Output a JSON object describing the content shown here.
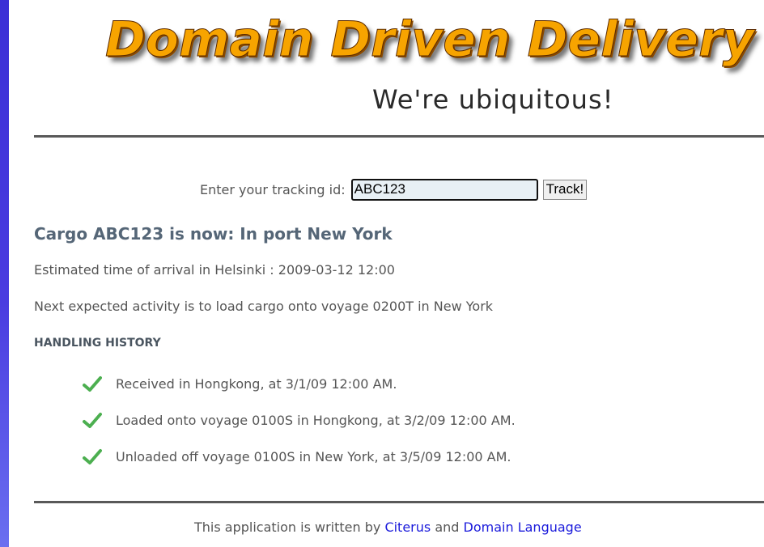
{
  "header": {
    "logo_text": "Domain Driven Delivery",
    "tagline": "We're ubiquitous!"
  },
  "tracking": {
    "label": "Enter your tracking id:",
    "input_value": "ABC123",
    "button_label": "Track!"
  },
  "cargo": {
    "status_heading": "Cargo ABC123 is now: In port New York",
    "eta": "Estimated time of arrival in Helsinki : 2009-03-12 12:00",
    "next_activity": "Next expected activity is to load cargo onto voyage 0200T in New York"
  },
  "history": {
    "heading": "HANDLING HISTORY",
    "icon": "checkmark-icon",
    "icon_color": "#4caf50",
    "events": [
      "Received in Hongkong, at 3/1/09 12:00 AM.",
      "Loaded onto voyage 0100S in Hongkong, at 3/2/09 12:00 AM.",
      "Unloaded off voyage 0100S in New York, at 3/5/09 12:00 AM."
    ]
  },
  "footer": {
    "prefix": "This application is written by",
    "link1": "Citerus",
    "conjunction": "and",
    "link2": "Domain Language",
    "link_color": "#1a1adb"
  }
}
